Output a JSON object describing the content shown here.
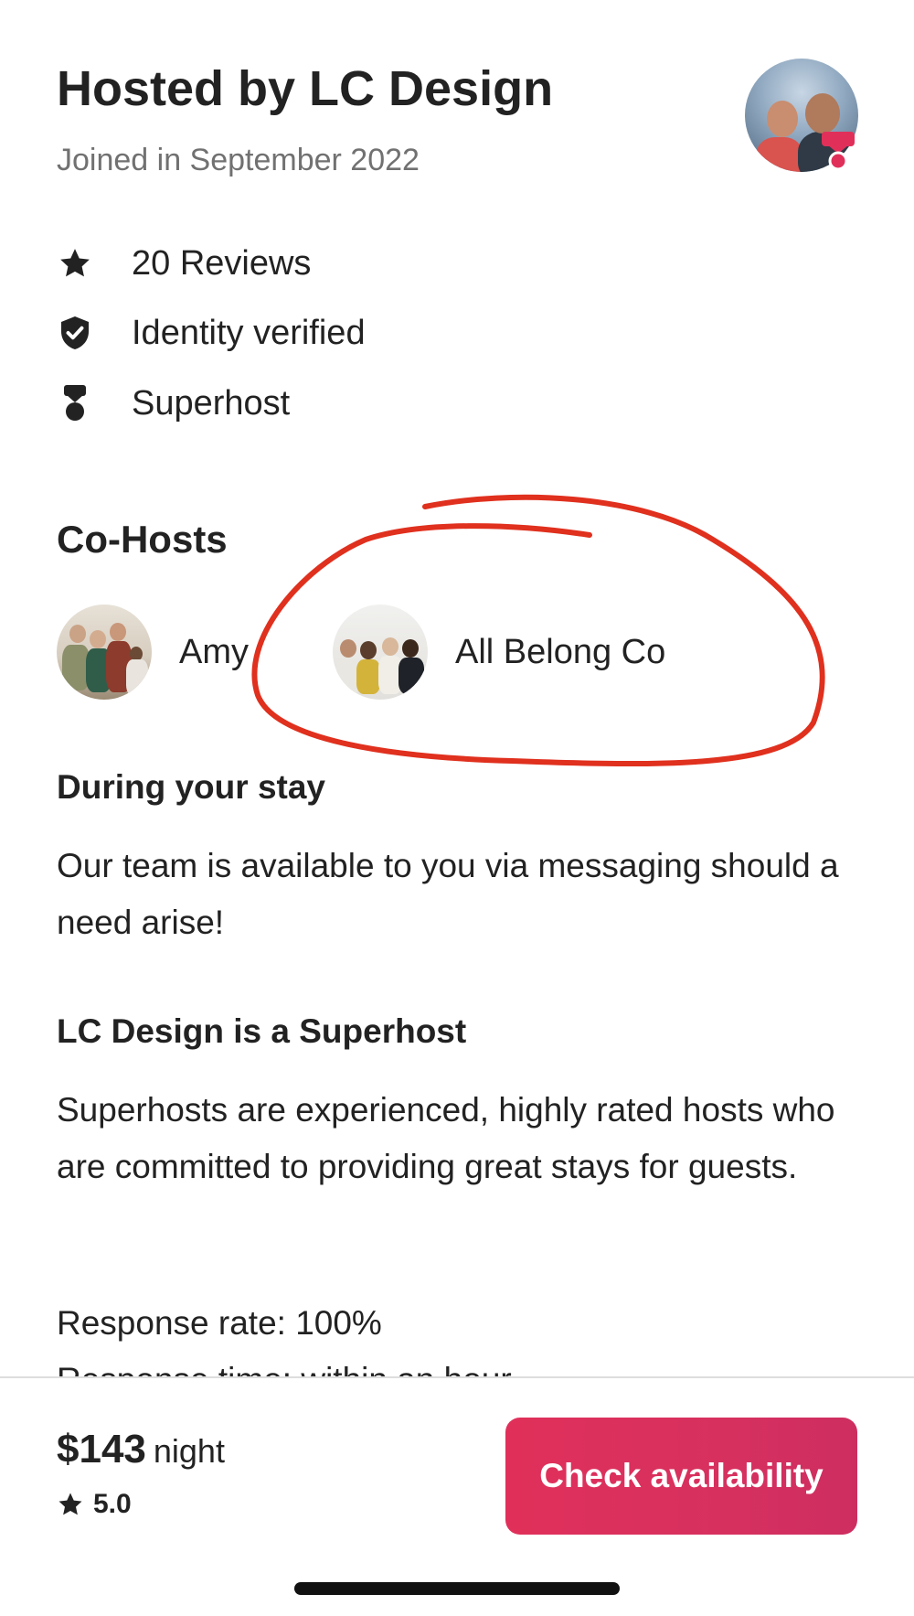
{
  "host": {
    "title": "Hosted by LC Design",
    "joined": "Joined in September 2022"
  },
  "stats": [
    {
      "icon": "star-icon",
      "label": "20 Reviews"
    },
    {
      "icon": "shield-check-icon",
      "label": "Identity verified"
    },
    {
      "icon": "superhost-icon",
      "label": "Superhost"
    }
  ],
  "cohosts": {
    "title": "Co-Hosts",
    "items": [
      {
        "name": "Amy"
      },
      {
        "name": "All Belong Co"
      }
    ]
  },
  "during_stay": {
    "title": "During your stay",
    "text": "Our team is available to you via messaging should a need arise!"
  },
  "superhost": {
    "title": "LC Design is a Superhost",
    "text": "Superhosts are experienced, highly rated hosts who are committed to providing great stays for guests."
  },
  "response_rate": "Response rate: 100%",
  "response_time_partial": "Response time: within an hour",
  "booking": {
    "price": "$143",
    "unit": "night",
    "rating": "5.0",
    "cta": "Check availability"
  },
  "colors": {
    "accent": "#DA3058",
    "annotation": "#E0301E",
    "muted_text": "#717171"
  }
}
